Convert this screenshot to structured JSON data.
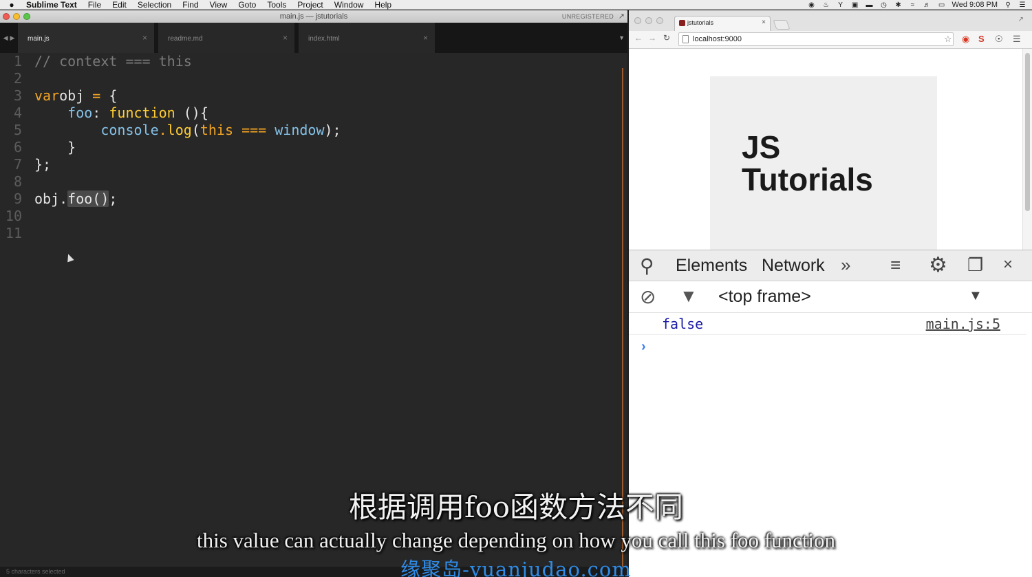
{
  "menubar": {
    "app_name": "Sublime Text",
    "items": [
      "File",
      "Edit",
      "Selection",
      "Find",
      "View",
      "Goto",
      "Tools",
      "Project",
      "Window",
      "Help"
    ],
    "clock": "Wed 9:08 PM"
  },
  "sublime": {
    "window_title": "main.js — jstutorials",
    "unregistered": "UNREGISTERED",
    "tabs": [
      {
        "label": "main.js",
        "active": true
      },
      {
        "label": "readme.md",
        "active": false
      },
      {
        "label": "index.html",
        "active": false
      }
    ],
    "line_numbers": [
      "1",
      "2",
      "3",
      "4",
      "5",
      "6",
      "7",
      "8",
      "9",
      "10",
      "11"
    ],
    "status": "5 characters selected"
  },
  "chrome": {
    "tab_title": "jstutorials",
    "url": "localhost:9000",
    "hero_title_line1": "JS",
    "hero_title_line2": "Tutorials"
  },
  "devtools": {
    "tabs": [
      "Elements",
      "Network"
    ],
    "frame_selector": "<top frame>",
    "log_value": "false",
    "log_source": "main.js:5"
  },
  "subtitles": {
    "chinese": "根据调用foo函数方法不同",
    "english": "this value can actually change depending on how you call this foo function",
    "watermark": "缘聚岛-yuanjudao.com"
  },
  "colors": {
    "editor_bg": "#272727",
    "keyword": "#f4a623",
    "function": "#ffcc32",
    "property": "#85c2e8",
    "console_value": "#1a1aa6"
  }
}
